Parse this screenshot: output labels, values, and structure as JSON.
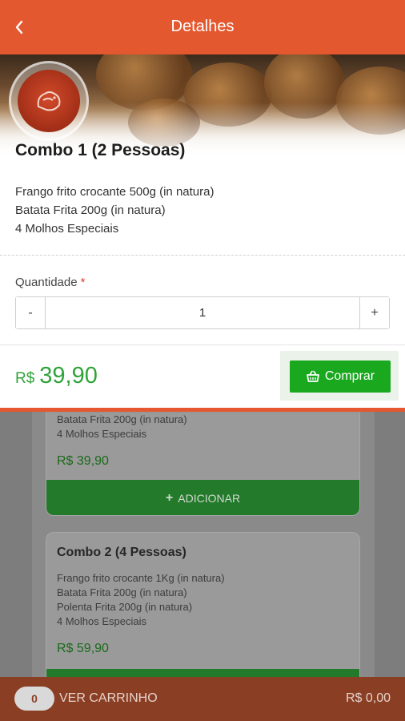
{
  "header": {
    "title": "Detalhes",
    "back_icon": "chevron-left-icon"
  },
  "detail": {
    "title": "Combo 1 (2 Pessoas)",
    "description": [
      "Frango frito crocante 500g (in natura)",
      "Batata Frita 200g (in natura)",
      "4 Molhos Especiais"
    ],
    "quantity_label": "Quantidade",
    "required_mark": "*",
    "quantity": {
      "minus": "-",
      "value": "1",
      "plus": "+"
    },
    "price_currency": "R$",
    "price_value": "39,90",
    "buy_label": "Comprar",
    "buy_icon": "shopping-basket-icon"
  },
  "background_list": {
    "card1": {
      "lines": [
        "Batata Frita 200g (in natura)",
        "4 Molhos Especiais"
      ],
      "price": "R$ 39,90",
      "add_label": "ADICIONAR"
    },
    "card2": {
      "title": "Combo 2 (4 Pessoas)",
      "lines": [
        "Frango frito crocante 1Kg (in natura)",
        "Batata Frita 200g (in natura)",
        "Polenta Frita 200g (in natura)",
        "4 Molhos Especiais"
      ],
      "price": "R$ 59,90"
    }
  },
  "cart": {
    "count": "0",
    "label": "VER CARRINHO",
    "total": "R$ 0,00"
  },
  "colors": {
    "header": "#e45830",
    "price_green": "#2fa33a",
    "buy_green": "#19a81e",
    "cart_bar": "#8a3f24"
  }
}
